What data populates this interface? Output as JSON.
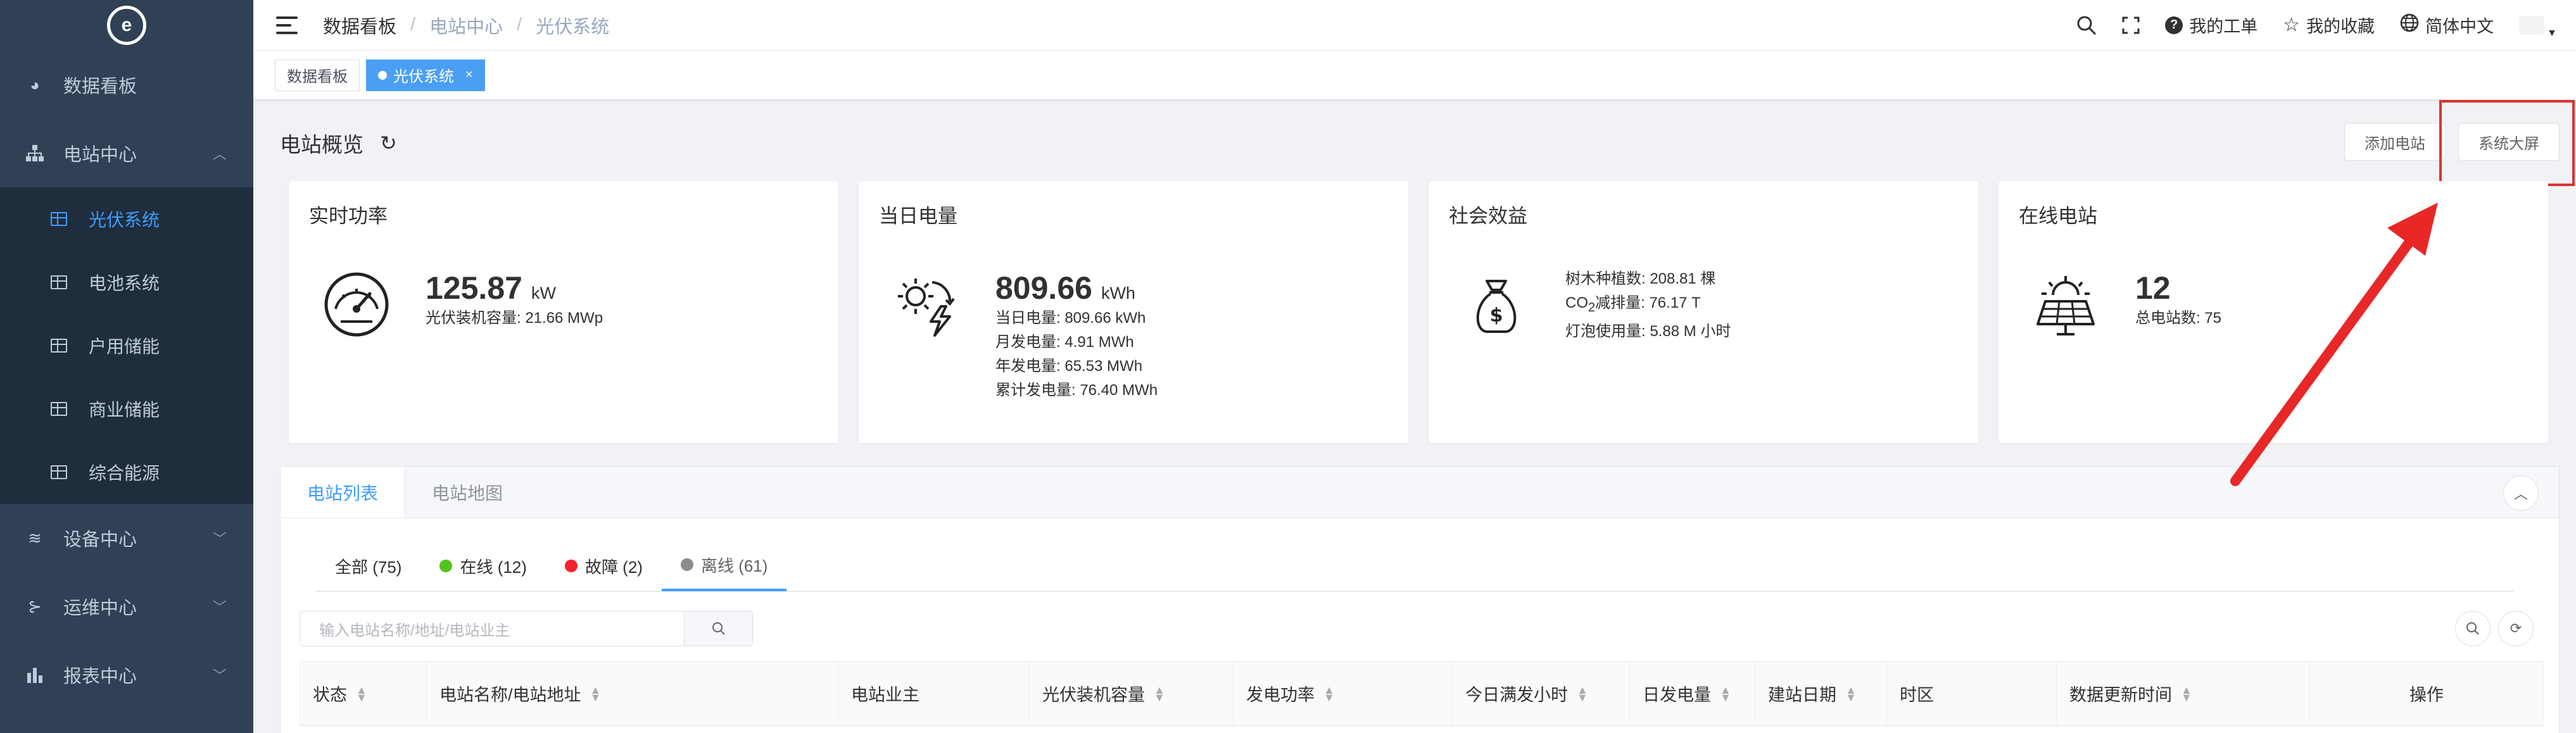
{
  "sidebar": {
    "logo": "e",
    "items": [
      {
        "label": "数据看板",
        "icon": "dashboard-icon"
      },
      {
        "label": "电站中心",
        "icon": "sitemap-icon",
        "expanded": true,
        "children": [
          {
            "label": "光伏系统",
            "active": true
          },
          {
            "label": "电池系统"
          },
          {
            "label": "户用储能"
          },
          {
            "label": "商业储能"
          },
          {
            "label": "综合能源"
          }
        ]
      },
      {
        "label": "设备中心",
        "icon": "layers-icon"
      },
      {
        "label": "运维中心",
        "icon": "tree-icon"
      },
      {
        "label": "报表中心",
        "icon": "bar-chart-icon"
      }
    ]
  },
  "header": {
    "breadcrumb": [
      "数据看板",
      "电站中心",
      "光伏系统"
    ],
    "my_tickets": "我的工单",
    "my_favorites": "我的收藏",
    "language": "简体中文"
  },
  "tags": [
    {
      "label": "数据看板"
    },
    {
      "label": "光伏系统",
      "active": true,
      "close": "×"
    }
  ],
  "overview": {
    "title": "电站概览",
    "add_station": "添加电站",
    "system_screen": "系统大屏"
  },
  "cards": {
    "power": {
      "title": "实时功率",
      "value": "125.87",
      "unit": "kW",
      "lines": [
        "光伏装机容量: 21.66 MWp"
      ]
    },
    "energy": {
      "title": "当日电量",
      "value": "809.66",
      "unit": "kWh",
      "lines": [
        "当日电量: 809.66 kWh",
        "月发电量: 4.91 MWh",
        "年发电量: 65.53 MWh",
        "累计发电量: 76.40 MWh"
      ]
    },
    "social": {
      "title": "社会效益",
      "trees": "树木种植数: 208.81 棵",
      "co2_prefix": "CO",
      "co2_sub": "2",
      "co2_rest": "减排量: 76.17 T",
      "bulbs": "灯泡使用量: 5.88 M 小时"
    },
    "online": {
      "title": "在线电站",
      "value": "12",
      "lines": [
        "总电站数: 75"
      ]
    }
  },
  "panel": {
    "tabs": [
      "电站列表",
      "电站地图"
    ],
    "filters": [
      {
        "label": "全部 (75)",
        "color": ""
      },
      {
        "label": "在线 (12)",
        "color": "#52c41a"
      },
      {
        "label": "故障 (2)",
        "color": "#f5222d"
      },
      {
        "label": "离线 (61)",
        "color": "#8c8c8c"
      }
    ],
    "search_placeholder": "输入电站名称/地址/电站业主",
    "columns": [
      "状态",
      "电站名称/电站地址",
      "电站业主",
      "光伏装机容量",
      "发电功率",
      "今日满发小时",
      "日发电量",
      "建站日期",
      "时区",
      "数据更新时间",
      "操作"
    ]
  },
  "colors": {
    "sidebar_bg": "#304156",
    "accent": "#409eff",
    "highlight": "#e03131"
  }
}
